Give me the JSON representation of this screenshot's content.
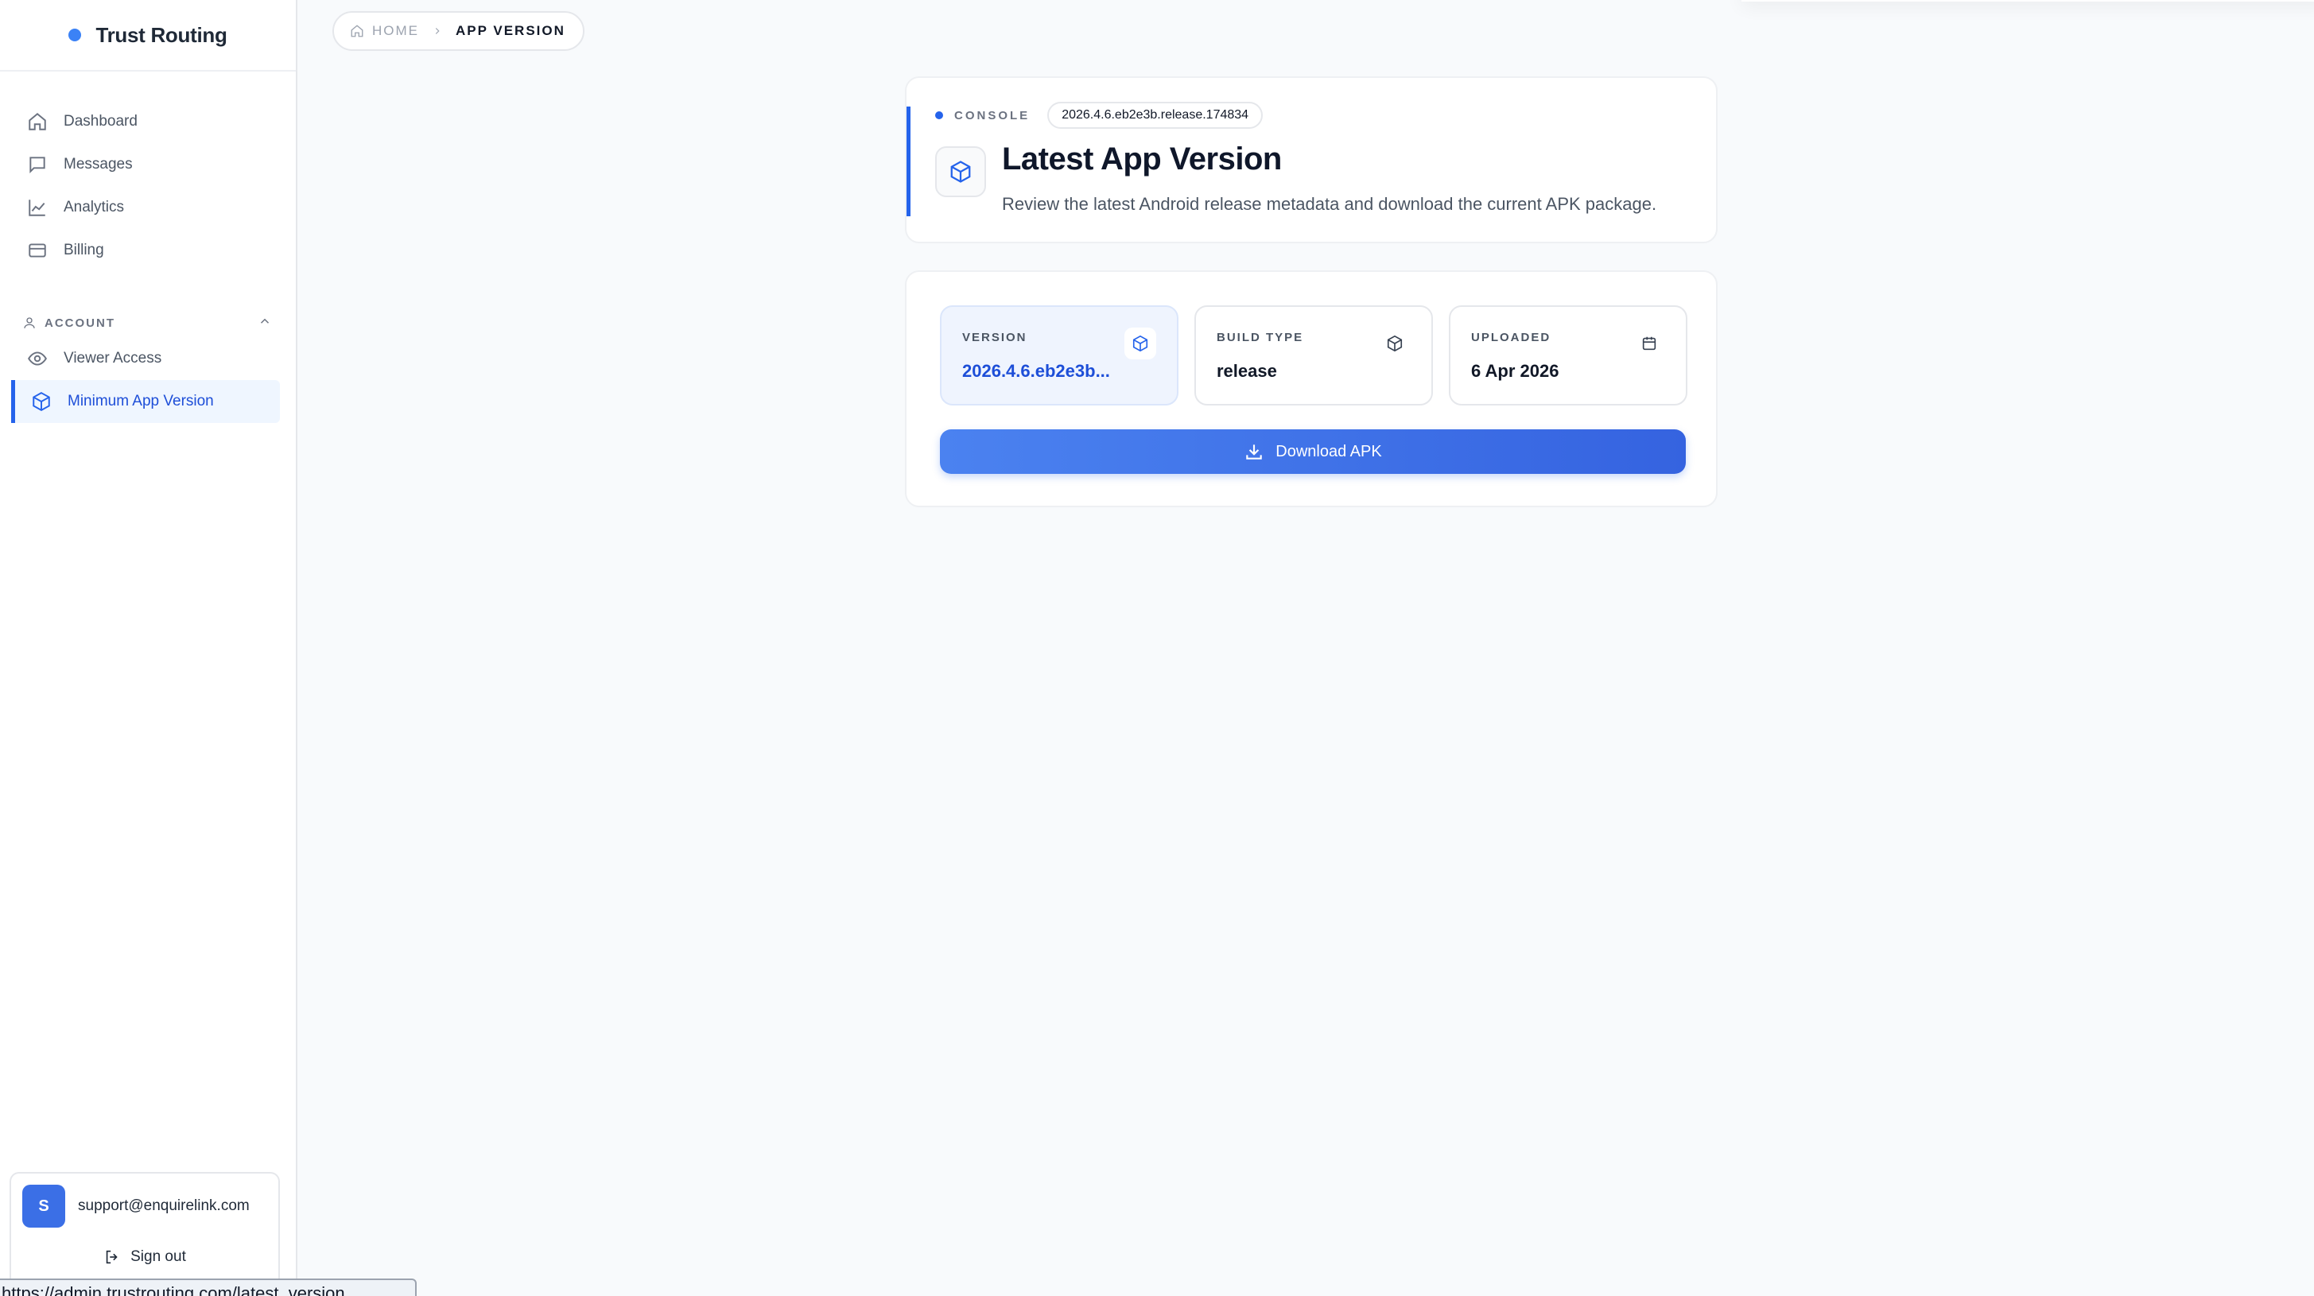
{
  "brand": {
    "name": "Trust Routing",
    "dot_color": "#3b82f6"
  },
  "sidebar": {
    "items": [
      {
        "label": "Dashboard",
        "icon": "home-icon"
      },
      {
        "label": "Messages",
        "icon": "message-icon"
      },
      {
        "label": "Analytics",
        "icon": "chart-line-icon"
      },
      {
        "label": "Billing",
        "icon": "credit-card-icon"
      }
    ],
    "account_section": {
      "title": "ACCOUNT",
      "icon": "user-icon",
      "expanded": true,
      "items": [
        {
          "label": "Viewer Access",
          "icon": "eye-icon",
          "active": false
        },
        {
          "label": "Minimum App Version",
          "icon": "package-icon",
          "active": true
        }
      ]
    }
  },
  "user": {
    "avatar_initial": "S",
    "email": "support@enquirelink.com",
    "signout_label": "Sign out"
  },
  "status_url": "https://admin.trustrouting.com/latest_version",
  "breadcrumb": {
    "home": "HOME",
    "current": "APP VERSION"
  },
  "header": {
    "console_label": "CONSOLE",
    "version_pill": "2026.4.6.eb2e3b.release.174834",
    "title": "Latest App Version",
    "subtitle": "Review the latest Android release metadata and download the current APK package."
  },
  "info": {
    "tiles": [
      {
        "label": "VERSION",
        "value": "2026.4.6.eb2e3b...",
        "icon": "package-icon"
      },
      {
        "label": "BUILD TYPE",
        "value": "release",
        "icon": "package-icon"
      },
      {
        "label": "UPLOADED",
        "value": "6 Apr 2026",
        "icon": "calendar-icon"
      }
    ],
    "download_label": "Download APK"
  },
  "colors": {
    "accent": "#2563eb",
    "active_bg": "#eff6ff",
    "background": "#f8fafc"
  }
}
